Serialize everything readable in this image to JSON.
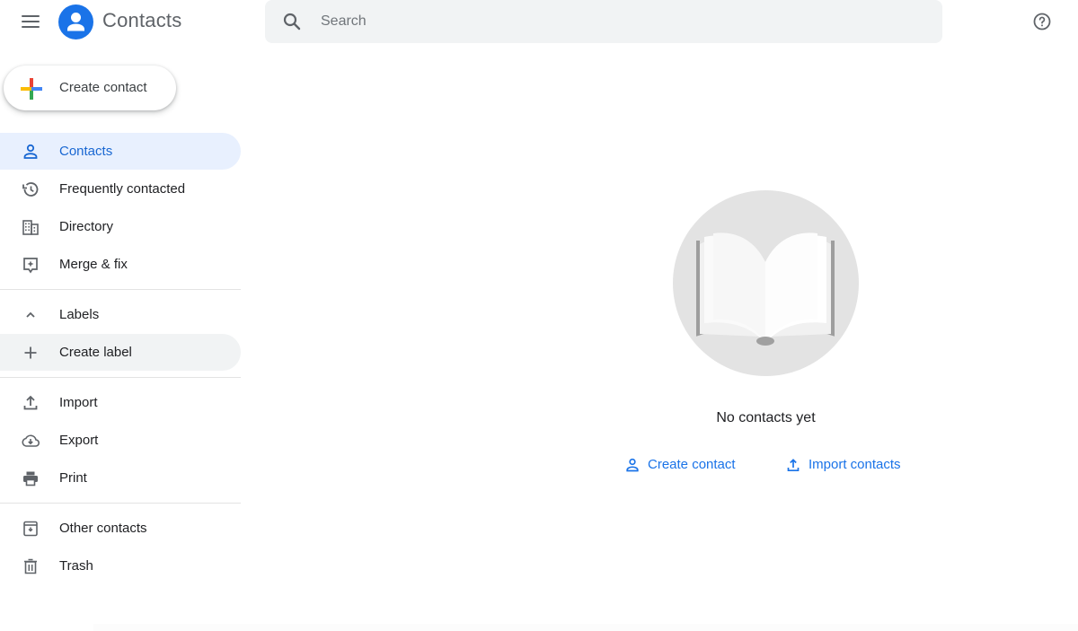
{
  "header": {
    "app_title": "Contacts",
    "search_placeholder": "Search",
    "search_value": "",
    "menu_icon": "hamburger-menu-icon",
    "help_icon": "help-circle-icon"
  },
  "fab": {
    "label": "Create contact",
    "icon": "plus-multicolor-icon"
  },
  "sidebar": {
    "main_items": [
      {
        "label": "Contacts",
        "icon": "person-icon",
        "active": true
      },
      {
        "label": "Frequently contacted",
        "icon": "history-icon"
      },
      {
        "label": "Directory",
        "icon": "domain-icon"
      },
      {
        "label": "Merge & fix",
        "icon": "merge-fix-icon"
      }
    ],
    "labels_section": {
      "label": "Labels",
      "icon": "chevron-up-icon",
      "expanded": true
    },
    "create_label": {
      "label": "Create label",
      "icon": "plus-icon"
    },
    "tool_items": [
      {
        "label": "Import",
        "icon": "upload-icon"
      },
      {
        "label": "Export",
        "icon": "cloud-download-icon"
      },
      {
        "label": "Print",
        "icon": "print-icon"
      }
    ],
    "bottom_items": [
      {
        "label": "Other contacts",
        "icon": "archive-icon"
      },
      {
        "label": "Trash",
        "icon": "trash-icon"
      }
    ]
  },
  "empty_state": {
    "illustration": "open-book-illustration",
    "title": "No contacts yet",
    "actions": [
      {
        "label": "Create contact",
        "icon": "person-icon"
      },
      {
        "label": "Import contacts",
        "icon": "upload-icon"
      }
    ]
  },
  "colors": {
    "accent": "#1a73e8",
    "active_bg": "#e8f0fe",
    "active_text": "#1967d2",
    "search_bg": "#f1f3f4"
  }
}
